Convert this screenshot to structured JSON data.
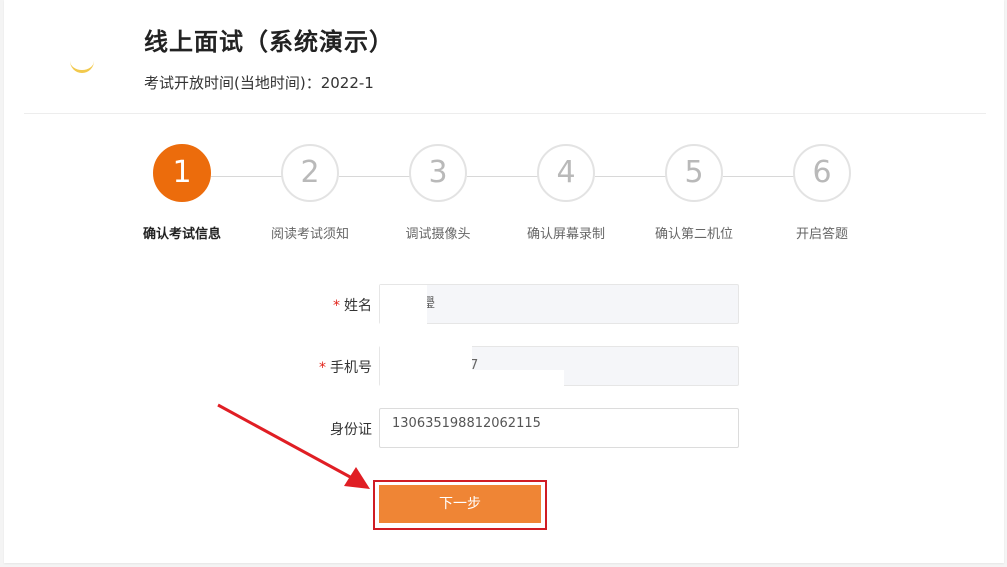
{
  "header": {
    "title": "线上面试（系统演示）",
    "subtitle": "考试开放时间(当地时间)：2022-1"
  },
  "steps": [
    {
      "number": "1",
      "label": "确认考试信息",
      "active": true
    },
    {
      "number": "2",
      "label": "阅读考试须知",
      "active": false
    },
    {
      "number": "3",
      "label": "调试摄像头",
      "active": false
    },
    {
      "number": "4",
      "label": "确认屏幕录制",
      "active": false
    },
    {
      "number": "5",
      "label": "确认第二机位",
      "active": false
    },
    {
      "number": "6",
      "label": "开启答题",
      "active": false
    }
  ],
  "form": {
    "name_label": "姓名",
    "name_value": "璺",
    "phone_label": "手机号",
    "phone_value": "7",
    "id_label": "身份证",
    "id_value": "130635198812062115",
    "required_mark": "*"
  },
  "actions": {
    "next_label": "下一步"
  },
  "colors": {
    "accent": "#ec6c0c",
    "button": "#ef8535",
    "highlight": "#d01c24"
  }
}
